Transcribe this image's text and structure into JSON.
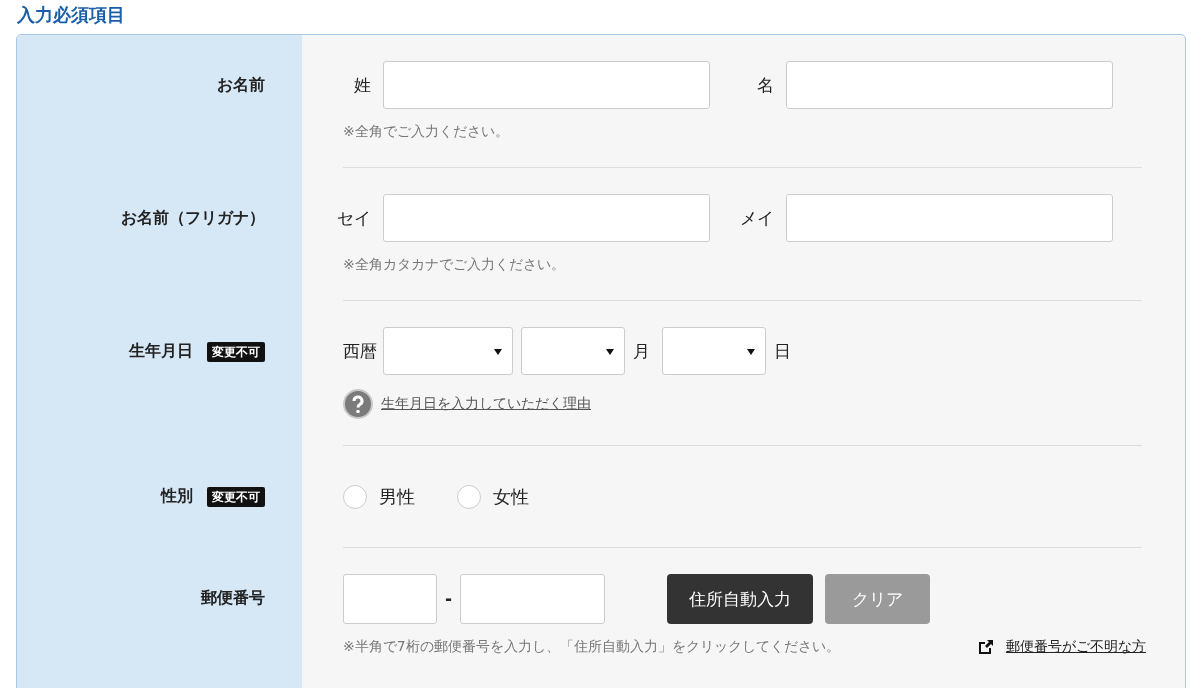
{
  "heading": "入力必須項目",
  "rows": [
    {
      "kind": "pair",
      "label": "お名前",
      "fields": [
        {
          "label": "姓"
        },
        {
          "label": "名"
        }
      ],
      "note": "※全角でご入力ください。"
    },
    {
      "kind": "pair",
      "label": "お名前（フリガナ）",
      "fields": [
        {
          "label": "セイ"
        },
        {
          "label": "メイ"
        }
      ],
      "note": "※全角カタカナでご入力ください。"
    },
    {
      "kind": "date",
      "label": "生年月日",
      "badge": "変更不可",
      "era": "西暦",
      "selects": [
        {
          "kind": "year"
        },
        {
          "kind": "month",
          "unit": "月"
        },
        {
          "kind": "day",
          "unit": "日"
        }
      ],
      "help_link": "生年月日を入力していただく理由"
    },
    {
      "kind": "radio",
      "label": "性別",
      "badge": "変更不可",
      "options": [
        {
          "label": "男性",
          "selected": false
        },
        {
          "label": "女性",
          "selected": false
        }
      ]
    },
    {
      "kind": "postal",
      "label": "郵便番号",
      "separator": "-",
      "buttons": [
        {
          "label": "住所自動入力",
          "disabled": false
        },
        {
          "label": "クリア",
          "disabled": true
        }
      ],
      "note": "※半角で7桁の郵便番号を入力し、「住所自動入力」をクリックしてください。",
      "link": "郵便番号がご不明な方"
    }
  ]
}
